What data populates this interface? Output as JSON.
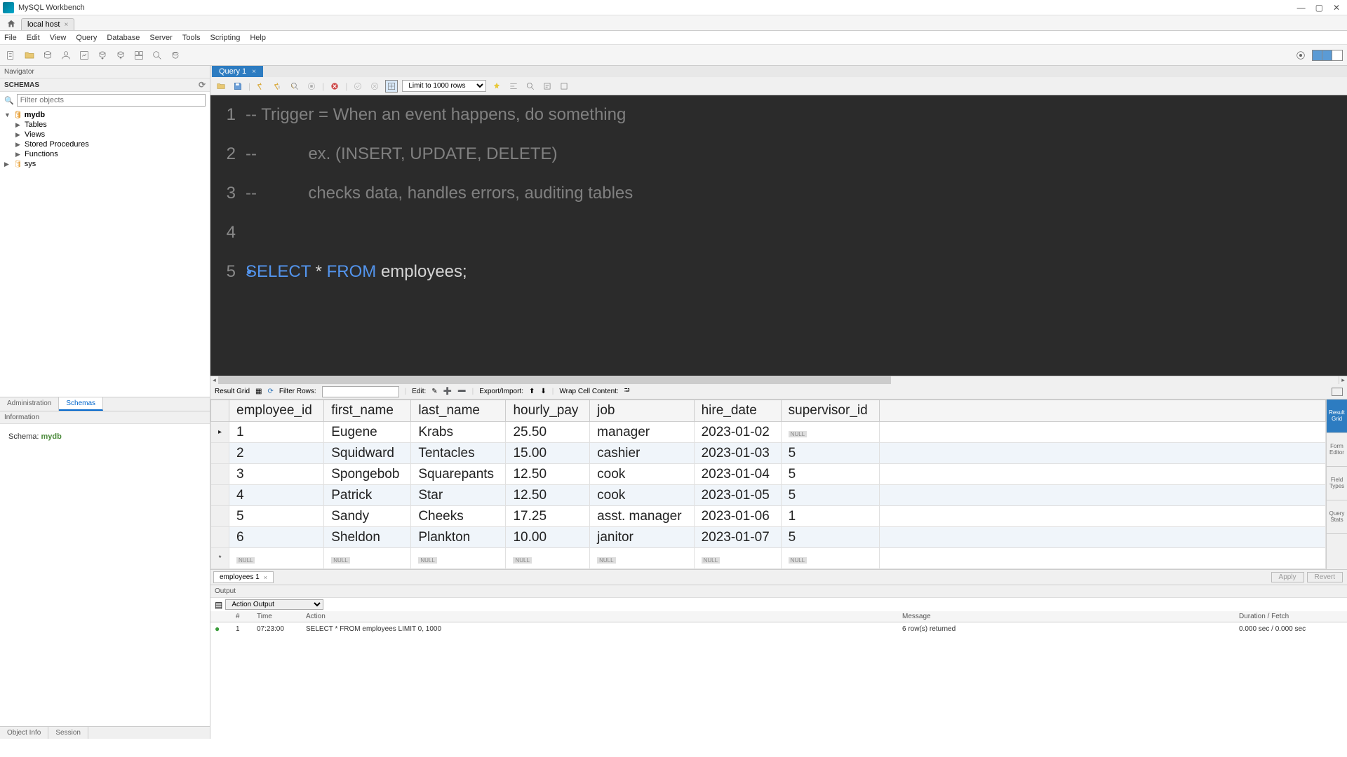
{
  "app_title": "MySQL Workbench",
  "connection_tab": "local host",
  "menu": [
    "File",
    "Edit",
    "View",
    "Query",
    "Database",
    "Server",
    "Tools",
    "Scripting",
    "Help"
  ],
  "navigator": {
    "header": "Navigator",
    "schemas_label": "SCHEMAS",
    "filter_placeholder": "Filter objects",
    "tree": {
      "db": "mydb",
      "children": [
        "Tables",
        "Views",
        "Stored Procedures",
        "Functions"
      ],
      "sys": "sys"
    },
    "tabs": {
      "admin": "Administration",
      "schemas": "Schemas"
    },
    "info_header": "Information",
    "schema_label": "Schema: ",
    "schema_name": "mydb",
    "bottom_tabs": {
      "object": "Object Info",
      "session": "Session"
    }
  },
  "query_tab": "Query 1",
  "limit_label": "Limit to 1000 rows",
  "code_lines": [
    {
      "n": "1",
      "type": "comment",
      "text": "-- Trigger = When an event happens, do something"
    },
    {
      "n": "2",
      "type": "comment",
      "text": "--           ex. (INSERT, UPDATE, DELETE)"
    },
    {
      "n": "3",
      "type": "comment",
      "text": "--           checks data, handles errors, auditing tables"
    },
    {
      "n": "4",
      "type": "blank",
      "text": ""
    },
    {
      "n": "5",
      "type": "sql",
      "kw1": "SELECT",
      "star": " * ",
      "kw2": "FROM",
      "ident": " employees",
      "end": ";"
    }
  ],
  "result_toolbar": {
    "result_grid": "Result Grid",
    "filter_rows": "Filter Rows:",
    "edit": "Edit:",
    "export_import": "Export/Import:",
    "wrap": "Wrap Cell Content:"
  },
  "grid_side": [
    "Result\nGrid",
    "Form\nEditor",
    "Field\nTypes",
    "Query\nStats"
  ],
  "columns": [
    "employee_id",
    "first_name",
    "last_name",
    "hourly_pay",
    "job",
    "hire_date",
    "supervisor_id"
  ],
  "rows": [
    [
      "1",
      "Eugene",
      "Krabs",
      "25.50",
      "manager",
      "2023-01-02",
      null
    ],
    [
      "2",
      "Squidward",
      "Tentacles",
      "15.00",
      "cashier",
      "2023-01-03",
      "5"
    ],
    [
      "3",
      "Spongebob",
      "Squarepants",
      "12.50",
      "cook",
      "2023-01-04",
      "5"
    ],
    [
      "4",
      "Patrick",
      "Star",
      "12.50",
      "cook",
      "2023-01-05",
      "5"
    ],
    [
      "5",
      "Sandy",
      "Cheeks",
      "17.25",
      "asst. manager",
      "2023-01-06",
      "1"
    ],
    [
      "6",
      "Sheldon",
      "Plankton",
      "10.00",
      "janitor",
      "2023-01-07",
      "5"
    ]
  ],
  "null_label": "NULL",
  "result_tab": "employees 1",
  "apply_btn": "Apply",
  "revert_btn": "Revert",
  "output": {
    "header": "Output",
    "type": "Action Output",
    "cols": {
      "idx": "#",
      "time": "Time",
      "action": "Action",
      "message": "Message",
      "duration": "Duration / Fetch"
    },
    "row": {
      "idx": "1",
      "time": "07:23:00",
      "action": "SELECT * FROM employees LIMIT 0, 1000",
      "message": "6 row(s) returned",
      "duration": "0.000 sec / 0.000 sec"
    }
  }
}
